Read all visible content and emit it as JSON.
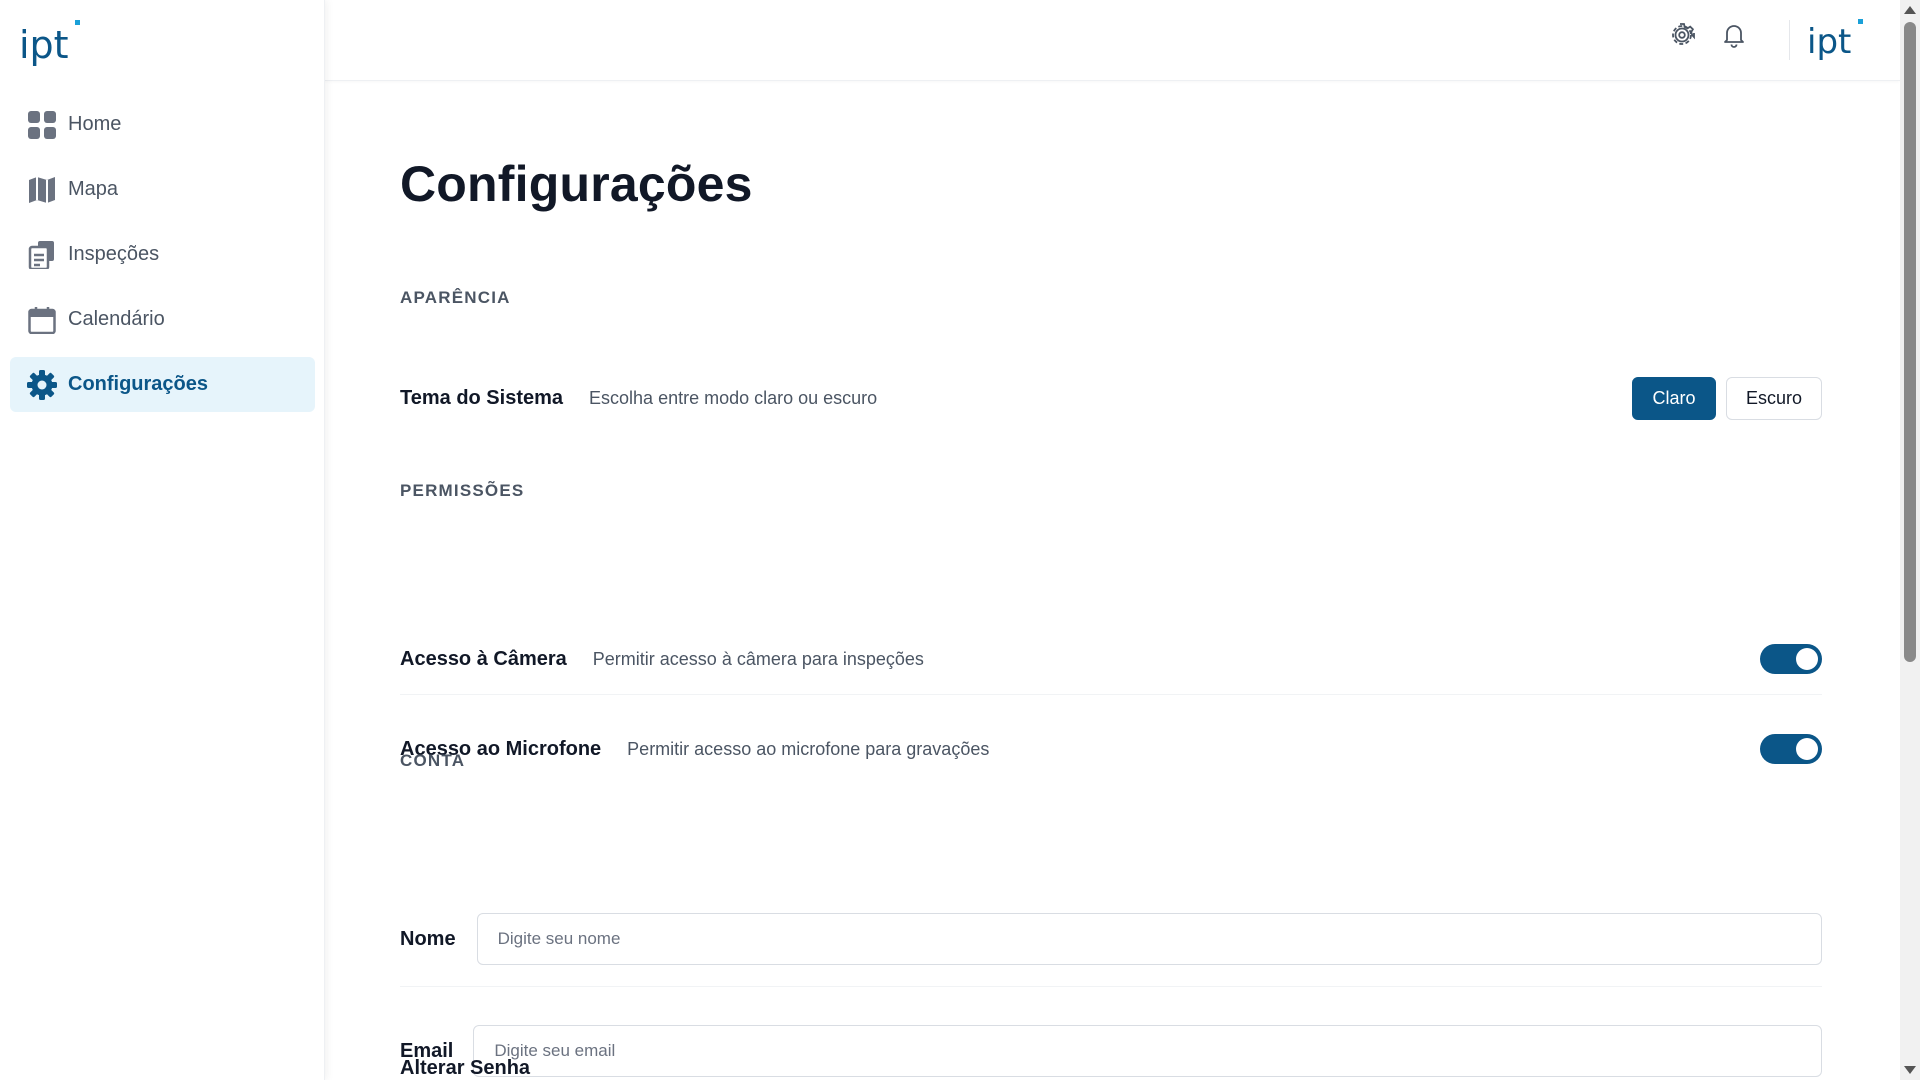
{
  "sidebar": {
    "logo_text": "ipt",
    "items": [
      {
        "label": "Home",
        "icon": "grid-icon",
        "active": false
      },
      {
        "label": "Mapa",
        "icon": "map-icon",
        "active": false
      },
      {
        "label": "Inspeções",
        "icon": "documents-icon",
        "active": false
      },
      {
        "label": "Calendário",
        "icon": "calendar-icon",
        "active": false
      },
      {
        "label": "Configurações",
        "icon": "gear-icon",
        "active": true
      }
    ]
  },
  "header": {
    "icons": [
      "gear-icon",
      "bell-icon"
    ],
    "logo_text": "ipt"
  },
  "main": {
    "title": "Configurações",
    "appearance": {
      "section_title": "APARÊNCIA",
      "theme_label": "Tema do Sistema",
      "theme_desc": "Escolha entre modo claro ou escuro",
      "light_label": "Claro",
      "dark_label": "Escuro",
      "selected": "Claro"
    },
    "permissions": {
      "section_title": "PERMISSÕES",
      "camera_label": "Acesso à Câmera",
      "camera_desc": "Permitir acesso à câmera para inspeções",
      "camera_enabled": true,
      "mic_label": "Acesso ao Microfone",
      "mic_desc": "Permitir acesso ao microfone para gravações",
      "mic_enabled": true
    },
    "account": {
      "section_title": "CONTA",
      "name_label": "Nome",
      "name_placeholder": "Digite seu nome",
      "name_value": "",
      "email_label": "Email",
      "email_placeholder": "Digite seu email",
      "email_value": "",
      "password_label": "Alterar Senha"
    }
  },
  "colors": {
    "primary": "#0b5688",
    "active_bg": "#e6f4fb",
    "text": "#111827",
    "muted": "#4b5563"
  }
}
